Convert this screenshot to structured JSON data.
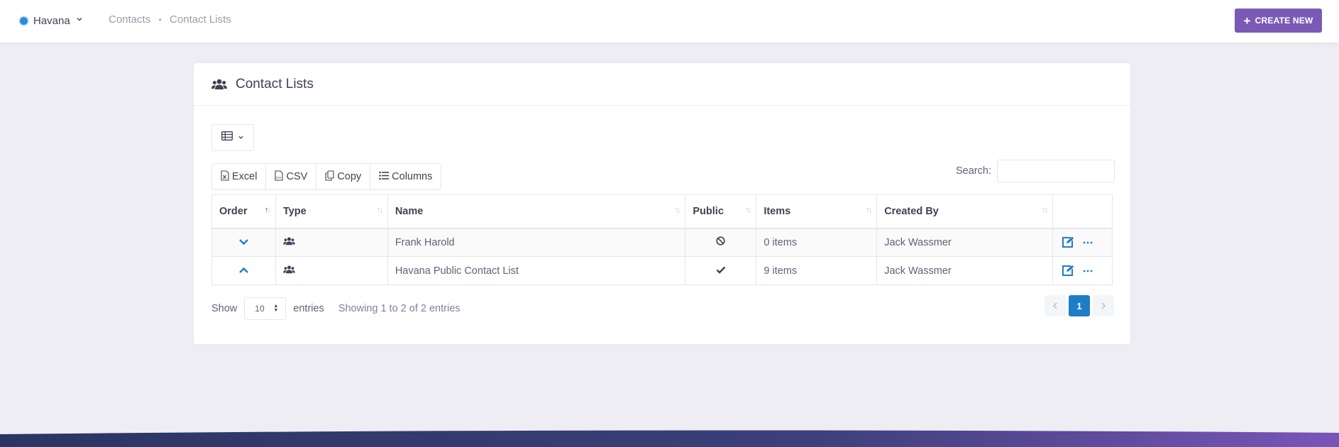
{
  "colors": {
    "accent": "#7b5ab6",
    "primary": "#1e7dc8",
    "page_bg": "#eeedf3",
    "workspace_dot": "#2e8bd9"
  },
  "topbar": {
    "workspace_name": "Havana",
    "breadcrumb": [
      "Contacts",
      "Contact Lists"
    ],
    "create_label": "CREATE NEW"
  },
  "card": {
    "title": "Contact Lists",
    "title_icon": "users-icon",
    "view_toggle_icon": "table-icon",
    "buttons": [
      {
        "label": "Excel",
        "icon": "excel-file-icon"
      },
      {
        "label": "CSV",
        "icon": "csv-file-icon"
      },
      {
        "label": "Copy",
        "icon": "copy-icon"
      },
      {
        "label": "Columns",
        "icon": "list-icon"
      }
    ],
    "search_label": "Search:",
    "search_value": ""
  },
  "table": {
    "columns": [
      "Order",
      "Type",
      "Name",
      "Public",
      "Items",
      "Created By",
      ""
    ],
    "rows": [
      {
        "order_icon": "chevron-down-icon",
        "type_icon": "users-icon",
        "name": "Frank Harold",
        "public_icon": "ban-icon",
        "items": "0 items",
        "created_by": "Jack Wassmer"
      },
      {
        "order_icon": "chevron-up-icon",
        "type_icon": "users-icon",
        "name": "Havana Public Contact List",
        "public_icon": "check-icon",
        "items": "9 items",
        "created_by": "Jack Wassmer"
      }
    ]
  },
  "footer": {
    "show_label": "Show",
    "length_value": "10",
    "entries_label": "entries",
    "info": "Showing 1 to 2 of 2 entries",
    "pages": [
      "1"
    ],
    "current_page": "1"
  }
}
